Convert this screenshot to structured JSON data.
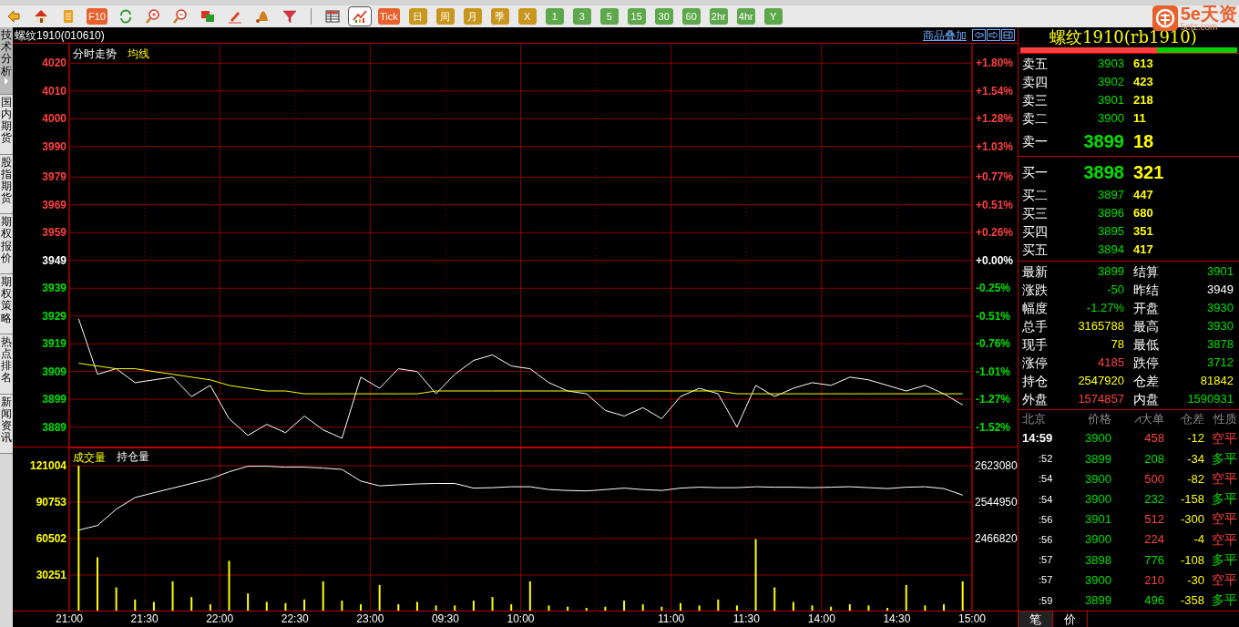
{
  "toolbar": [
    {
      "kind": "icon",
      "selected": false
    },
    {
      "kind": "icon",
      "selected": false
    },
    {
      "kind": "icon",
      "selected": false
    },
    {
      "kind": "text",
      "label": "F10",
      "color": "#e8602c",
      "selected": false
    },
    {
      "kind": "icon",
      "selected": false
    },
    {
      "kind": "icon",
      "selected": false
    },
    {
      "kind": "icon",
      "selected": false
    },
    {
      "kind": "icon",
      "selected": false
    },
    {
      "kind": "icon",
      "selected": false
    },
    {
      "kind": "icon",
      "selected": false
    },
    {
      "kind": "icon",
      "selected": false
    },
    {
      "kind": "separator"
    },
    {
      "kind": "icon",
      "selected": false
    },
    {
      "kind": "icon",
      "selected": true
    },
    {
      "kind": "text",
      "label": "Tick",
      "color": "#e8602c",
      "selected": false
    },
    {
      "kind": "text",
      "label": "日",
      "color": "#c8961c",
      "selected": false
    },
    {
      "kind": "text",
      "label": "周",
      "color": "#c8961c",
      "selected": false
    },
    {
      "kind": "text",
      "label": "月",
      "color": "#c8961c",
      "selected": false
    },
    {
      "kind": "text",
      "label": "季",
      "color": "#c8961c",
      "selected": false
    },
    {
      "kind": "text",
      "label": "X",
      "color": "#c8961c",
      "selected": false
    },
    {
      "kind": "text",
      "label": "1",
      "color": "#5ca84a",
      "selected": false
    },
    {
      "kind": "text",
      "label": "3",
      "color": "#5ca84a",
      "selected": false
    },
    {
      "kind": "text",
      "label": "5",
      "color": "#5ca84a",
      "selected": false
    },
    {
      "kind": "text",
      "label": "15",
      "color": "#5ca84a",
      "selected": false
    },
    {
      "kind": "text",
      "label": "30",
      "color": "#5ca84a",
      "selected": false
    },
    {
      "kind": "text",
      "label": "60",
      "color": "#5ca84a",
      "selected": false
    },
    {
      "kind": "text",
      "label": "2hr",
      "color": "#5ca84a",
      "selected": false
    },
    {
      "kind": "text",
      "label": "4hr",
      "color": "#5ca84a",
      "selected": false
    },
    {
      "kind": "text",
      "label": "Y",
      "color": "#5ca84a",
      "selected": false
    }
  ],
  "logo": {
    "text": "5e天资",
    "subtext": "5etz.com"
  },
  "side_tabs": [
    {
      "label": "技术分析",
      "selected": true
    },
    {
      "label": "国内期货",
      "selected": false
    },
    {
      "label": "股指期货",
      "selected": false
    },
    {
      "label": "期权报价",
      "selected": false
    },
    {
      "label": "期权策略",
      "selected": false
    },
    {
      "label": "热点排名",
      "selected": false
    },
    {
      "label": "新闻资讯",
      "selected": false
    }
  ],
  "chart_header": {
    "title": "螺纹1910(010610)",
    "overlay_link": "商品叠加"
  },
  "price_chart": {
    "right_ticks": [
      {
        "label": "+1.80%",
        "color": "#ff4040"
      },
      {
        "label": "+1.54%",
        "color": "#ff4040"
      },
      {
        "label": "+1.28%",
        "color": "#ff4040"
      },
      {
        "label": "+1.03%",
        "color": "#ff4040"
      },
      {
        "label": "+0.77%",
        "color": "#ff4040"
      },
      {
        "label": "+0.51%",
        "color": "#ff4040"
      },
      {
        "label": "+0.26%",
        "color": "#ff4040"
      },
      {
        "label": "+0.00%",
        "color": "#ffffff"
      },
      {
        "label": "-0.25%",
        "color": "#00e000"
      },
      {
        "label": "-0.51%",
        "color": "#00e000"
      },
      {
        "label": "-0.76%",
        "color": "#00e000"
      },
      {
        "label": "-1.01%",
        "color": "#00e000"
      },
      {
        "label": "-1.27%",
        "color": "#00e000"
      },
      {
        "label": "-1.52%",
        "color": "#00e000"
      }
    ],
    "chart_data": {
      "type": "line",
      "grid": true,
      "ylim": [
        3882,
        4027
      ],
      "yticks": [
        4020,
        4010,
        4000,
        3990,
        3979,
        3969,
        3959,
        3949,
        3939,
        3929,
        3919,
        3909,
        3899,
        3889
      ],
      "series": [
        {
          "name": "分时走势",
          "color": "#ffffff",
          "values": [
            3928,
            3908,
            3910,
            3905,
            3906,
            3907,
            3900,
            3904,
            3892,
            3886,
            3890,
            3887,
            3893,
            3888,
            3885,
            3907,
            3903,
            3910,
            3909,
            3901,
            3908,
            3913,
            3915,
            3911,
            3910,
            3905,
            3902,
            3901,
            3895,
            3893,
            3896,
            3892,
            3900,
            3903,
            3901,
            3889,
            3904,
            3900,
            3903,
            3905,
            3904,
            3907,
            3906,
            3904,
            3902,
            3904,
            3901,
            3897
          ]
        },
        {
          "name": "均线",
          "color": "#ffff00",
          "values": [
            3912,
            3911,
            3910,
            3910,
            3909,
            3908,
            3907,
            3906,
            3904,
            3903,
            3902,
            3902,
            3901,
            3901,
            3901,
            3901,
            3901,
            3901,
            3901,
            3902,
            3902,
            3902,
            3902,
            3902,
            3902,
            3902,
            3902,
            3902,
            3902,
            3902,
            3902,
            3902,
            3902,
            3902,
            3902,
            3901,
            3901,
            3901,
            3901,
            3901,
            3901,
            3901,
            3901,
            3901,
            3901,
            3901,
            3901,
            3901
          ]
        }
      ]
    }
  },
  "volume_chart": {
    "chart_data": {
      "type": "bar",
      "grid": true,
      "ylim": [
        0,
        121004
      ],
      "yticks": [
        30251,
        60502,
        90753,
        121004
      ],
      "series": [
        {
          "name": "成交量",
          "color": "#ffff00",
          "values": [
            121000,
            45000,
            20000,
            10000,
            8000,
            25000,
            12000,
            6000,
            42000,
            15000,
            8000,
            7000,
            10000,
            25000,
            9000,
            6000,
            22000,
            6000,
            8000,
            5000,
            5000,
            9000,
            12000,
            6000,
            25000,
            5000,
            4000,
            3000,
            4000,
            9000,
            6000,
            4000,
            7000,
            5000,
            10000,
            5000,
            60000,
            20000,
            8000,
            5000,
            4000,
            6000,
            5000,
            3000,
            22000,
            5000,
            6000,
            25000
          ]
        }
      ]
    }
  },
  "open_interest_chart": {
    "chart_data": {
      "type": "line",
      "ylim": [
        2466820,
        2662145
      ],
      "yticks": [
        2466820,
        2544950,
        2623080
      ],
      "series": [
        {
          "name": "持仓量",
          "color": "#ffffff",
          "values": [
            2485000,
            2495000,
            2530000,
            2555000,
            2565000,
            2575000,
            2585000,
            2595000,
            2610000,
            2622000,
            2622000,
            2620000,
            2620000,
            2618000,
            2615000,
            2590000,
            2580000,
            2582000,
            2584000,
            2585000,
            2585000,
            2575000,
            2576000,
            2578000,
            2578000,
            2572000,
            2570000,
            2569000,
            2572000,
            2575000,
            2572000,
            2570000,
            2575000,
            2577000,
            2576000,
            2576000,
            2578000,
            2577000,
            2577000,
            2576000,
            2577000,
            2578000,
            2576000,
            2574000,
            2577000,
            2578000,
            2574000,
            2560000
          ]
        }
      ]
    }
  },
  "time_axis": [
    "21:00",
    "21:30",
    "22:00",
    "22:30",
    "23:00",
    "09:30",
    "10:00",
    "11:00",
    "11:30",
    "14:00",
    "14:30",
    "15:00"
  ],
  "quote": {
    "title": "螺纹1910(rb1910)",
    "ratio_bar": {
      "level": 0.63
    },
    "asks": [
      {
        "kind": "normal",
        "label": "卖五",
        "price": "3903",
        "volume": "613"
      },
      {
        "kind": "normal",
        "label": "卖四",
        "price": "3902",
        "volume": "423"
      },
      {
        "kind": "normal",
        "label": "卖三",
        "price": "3901",
        "volume": "218"
      },
      {
        "kind": "normal",
        "label": "卖二",
        "price": "3900",
        "volume": "11"
      },
      {
        "kind": "best",
        "label": "卖一",
        "price": "3899",
        "volume": "18"
      }
    ],
    "bids": [
      {
        "kind": "best",
        "label": "买一",
        "price": "3898",
        "volume": "321"
      },
      {
        "kind": "normal",
        "label": "买二",
        "price": "3897",
        "volume": "447"
      },
      {
        "kind": "normal",
        "label": "买三",
        "price": "3896",
        "volume": "680"
      },
      {
        "kind": "normal",
        "label": "买四",
        "price": "3895",
        "volume": "351"
      },
      {
        "kind": "normal",
        "label": "买五",
        "price": "3894",
        "volume": "417"
      }
    ],
    "stats": [
      {
        "label": "最新",
        "value": "3899",
        "color": "#00e000"
      },
      {
        "label": "结算",
        "value": "3901",
        "color": "#00e000"
      },
      {
        "label": "涨跌",
        "value": "-50",
        "color": "#00e000"
      },
      {
        "label": "昨结",
        "value": "3949",
        "color": "#ffffff"
      },
      {
        "label": "幅度",
        "value": "-1.27%",
        "color": "#00e000"
      },
      {
        "label": "开盘",
        "value": "3930",
        "color": "#00e000"
      },
      {
        "label": "总手",
        "value": "3165788",
        "color": "#ffff00"
      },
      {
        "label": "最高",
        "value": "3930",
        "color": "#00e000"
      },
      {
        "label": "现手",
        "value": "78",
        "color": "#ffff00"
      },
      {
        "label": "最低",
        "value": "3878",
        "color": "#00e000"
      },
      {
        "label": "涨停",
        "value": "4185",
        "color": "#ff4040"
      },
      {
        "label": "跌停",
        "value": "3712",
        "color": "#00e000"
      },
      {
        "label": "持仓",
        "value": "2547920",
        "color": "#ffff00"
      },
      {
        "label": "仓差",
        "value": "81842",
        "color": "#ffff00"
      },
      {
        "label": "外盘",
        "value": "1574857",
        "color": "#ff4040"
      },
      {
        "label": "内盘",
        "value": "1590931",
        "color": "#00e000"
      }
    ],
    "trades_header": [
      "北京",
      "价格",
      "⩘大单",
      "仓差",
      "性质"
    ],
    "trades": [
      {
        "kind": "full",
        "time": "14:59",
        "price": "3900",
        "size": {
          "text": "458",
          "color": "#ff4040"
        },
        "oi_change": "-12",
        "nature": {
          "text": "空平",
          "color": "#ff4040"
        }
      },
      {
        "kind": "short",
        "time": ":52",
        "price": "3899",
        "size": {
          "text": "208",
          "color": "#00e000"
        },
        "oi_change": "-34",
        "nature": {
          "text": "多平",
          "color": "#00e000"
        }
      },
      {
        "kind": "short",
        "time": ":54",
        "price": "3900",
        "size": {
          "text": "500",
          "color": "#ff4040"
        },
        "oi_change": "-82",
        "nature": {
          "text": "空平",
          "color": "#ff4040"
        }
      },
      {
        "kind": "short",
        "time": ":54",
        "price": "3900",
        "size": {
          "text": "232",
          "color": "#00e000"
        },
        "oi_change": "-158",
        "nature": {
          "text": "多平",
          "color": "#00e000"
        }
      },
      {
        "kind": "short",
        "time": ":56",
        "price": "3901",
        "size": {
          "text": "512",
          "color": "#ff4040"
        },
        "oi_change": "-300",
        "nature": {
          "text": "空平",
          "color": "#ff4040"
        }
      },
      {
        "kind": "short",
        "time": ":56",
        "price": "3900",
        "size": {
          "text": "224",
          "color": "#ff4040"
        },
        "oi_change": "-4",
        "nature": {
          "text": "空平",
          "color": "#ff4040"
        }
      },
      {
        "kind": "short",
        "time": ":57",
        "price": "3898",
        "size": {
          "text": "776",
          "color": "#00e000"
        },
        "oi_change": "-108",
        "nature": {
          "text": "多平",
          "color": "#00e000"
        }
      },
      {
        "kind": "short",
        "time": ":57",
        "price": "3900",
        "size": {
          "text": "210",
          "color": "#ff4040"
        },
        "oi_change": "-30",
        "nature": {
          "text": "空平",
          "color": "#ff4040"
        }
      },
      {
        "kind": "short",
        "time": ":59",
        "price": "3899",
        "size": {
          "text": "496",
          "color": "#00e000"
        },
        "oi_change": "-358",
        "nature": {
          "text": "多平",
          "color": "#00e000"
        }
      }
    ],
    "bottom_tabs": [
      {
        "label": "笔",
        "selected": true
      },
      {
        "label": "价",
        "selected": false
      }
    ]
  }
}
